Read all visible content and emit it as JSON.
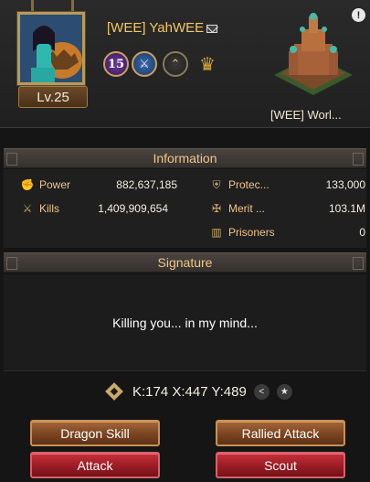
{
  "player": {
    "name": "[WEE] YahWEE",
    "level_label": "Lv.25",
    "badge_level": "15"
  },
  "castle": {
    "name": "[WEE] Worl..."
  },
  "info": {
    "title": "Information",
    "power_label": "Power",
    "power_value": "882,637,185",
    "kills_label": "Kills",
    "kills_value": "1,409,909,654",
    "protect_label": "Protec...",
    "protect_value": "133,000",
    "merit_label": "Merit ...",
    "merit_value": "103.1M",
    "prisoners_label": "Prisoners",
    "prisoners_value": "0"
  },
  "signature": {
    "title": "Signature",
    "text": "Killing you... in my mind..."
  },
  "location": {
    "coords": "K:174 X:447 Y:489"
  },
  "buttons": {
    "dragon_skill": "Dragon Skill",
    "rallied_attack": "Rallied Attack",
    "attack": "Attack",
    "scout": "Scout"
  },
  "icons": {
    "info": "info-icon",
    "mail": "mail-icon",
    "share": "share-icon",
    "favorite": "star-icon",
    "pin": "location-pin-icon"
  },
  "colors": {
    "gold_text": "#f3c864",
    "brown_button": "#7a4420",
    "red_button": "#9a1c24"
  }
}
